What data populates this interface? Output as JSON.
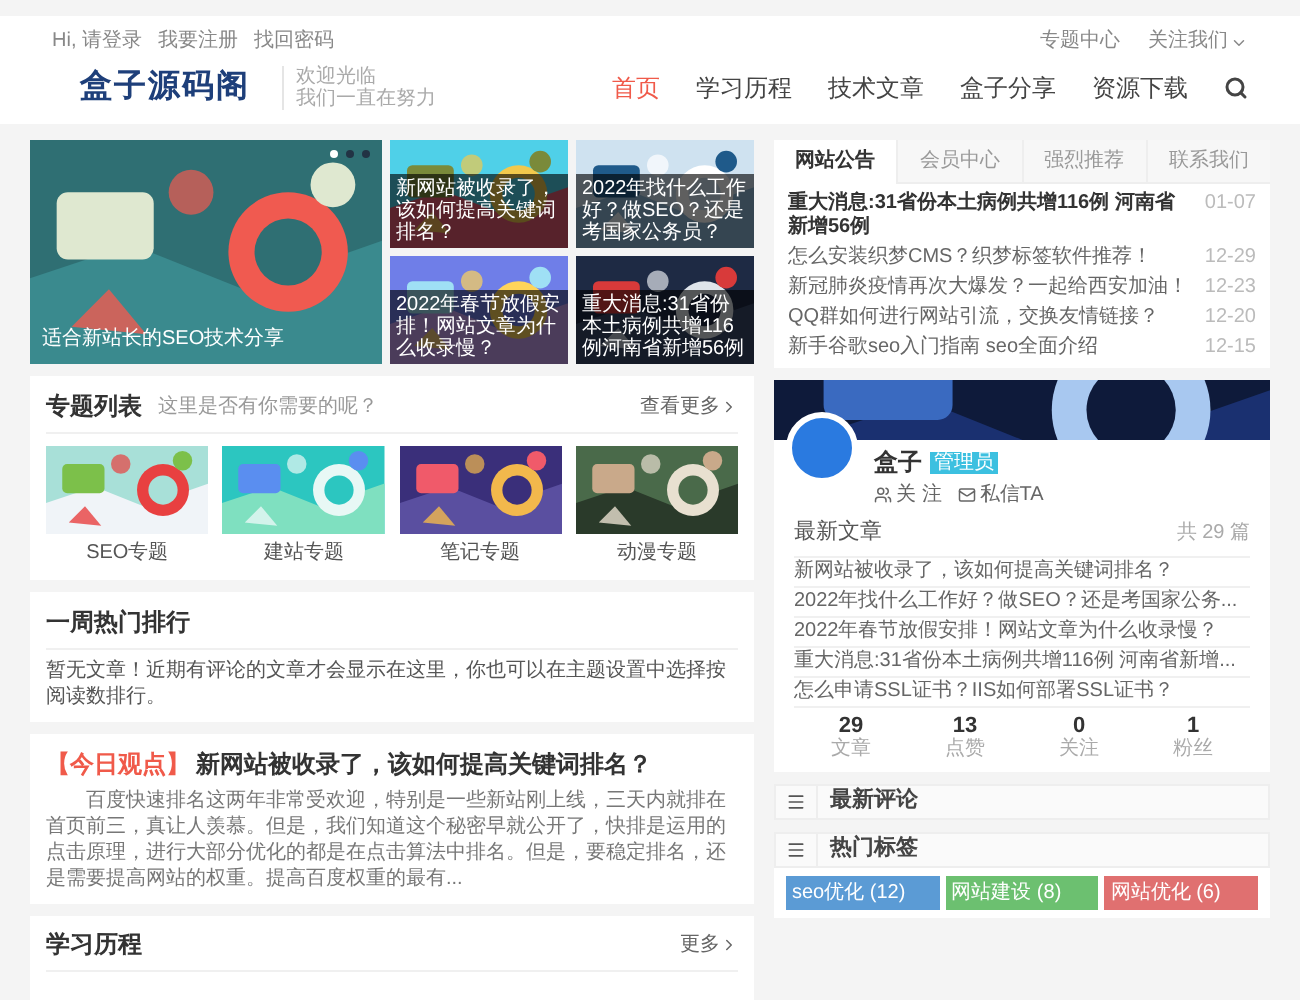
{
  "top_bar": {
    "left_links": [
      "Hi, 请登录",
      "我要注册",
      "找回密码"
    ],
    "right_links": [
      {
        "label": "专题中心",
        "dropdown": false
      },
      {
        "label": "关注我们",
        "dropdown": true
      }
    ]
  },
  "header": {
    "logo": "盒子源码阁",
    "tagline": [
      "欢迎光临",
      "我们一直在努力"
    ],
    "nav": [
      {
        "label": "首页",
        "selected": true
      },
      {
        "label": "学习历程",
        "selected": false
      },
      {
        "label": "技术文章",
        "selected": false
      },
      {
        "label": "盒子分享",
        "selected": false
      },
      {
        "label": "资源下载",
        "selected": false
      }
    ]
  },
  "slider": {
    "caption": "适合新站长的SEO技术分享",
    "dots": [
      {
        "selected": true
      },
      {
        "selected": false
      },
      {
        "selected": false
      }
    ],
    "cards": [
      {
        "caption": "新网站被收录了，该如何提高关键词排名？"
      },
      {
        "caption": "2022年找什么工作好？做SEO？还是考国家公务员？"
      },
      {
        "caption": "2022年春节放假安排！网站文章为什么收录慢？"
      },
      {
        "caption": "重大消息:31省份本土病例共增116例河南省新增56例"
      }
    ]
  },
  "topics": {
    "title": "专题列表",
    "subtitle": "这里是否有你需要的呢？",
    "more": "查看更多",
    "items": [
      "SEO专题",
      "建站专题",
      "笔记专题",
      "动漫专题"
    ]
  },
  "weekly": {
    "title": "一周热门排行",
    "text": "暂无文章！近期有评论的文章才会显示在这里，你也可以在主题设置中选择按阅读数排行。"
  },
  "today": {
    "tag": "【今日观点】",
    "title": "新网站被收录了，该如何提高关键词排名？",
    "excerpt": "百度快速排名这两年非常受欢迎，特别是一些新站刚上线，三天内就排在首页前三，真让人羡慕。但是，我们知道这个秘密早就公开了，快排是运用的点击原理，进行大部分优化的都是在点击算法中排名。但是，要稳定排名，还是需要提高网站的权重。提高百度权重的最有..."
  },
  "learning": {
    "title": "学习历程",
    "more": "更多"
  },
  "notice_tabs": [
    {
      "label": "网站公告",
      "selected": true
    },
    {
      "label": "会员中心",
      "selected": false
    },
    {
      "label": "强烈推荐",
      "selected": false
    },
    {
      "label": "联系我们",
      "selected": false
    }
  ],
  "notices": [
    {
      "title": "重大消息:31省份本土病例共增116例 河南省新增56例",
      "date": "01-07",
      "bold": true
    },
    {
      "title": "怎么安装织梦CMS？织梦标签软件推荐！",
      "date": "12-29",
      "bold": false
    },
    {
      "title": "新冠肺炎疫情再次大爆发？一起给西安加油！",
      "date": "12-23",
      "bold": false
    },
    {
      "title": "QQ群如何进行网站引流，交换友情链接？",
      "date": "12-20",
      "bold": false
    },
    {
      "title": "新手谷歌seo入门指南 seo全面介绍",
      "date": "12-15",
      "bold": false
    }
  ],
  "profile": {
    "name": "盒子",
    "badge": "管理员",
    "actions": [
      {
        "kind": "follow",
        "label": "关 注"
      },
      {
        "kind": "message",
        "label": "私信TA"
      }
    ],
    "latest_title": "最新文章",
    "latest_count": "共 29 篇",
    "articles": [
      "新网站被收录了，该如何提高关键词排名？",
      "2022年找什么工作好？做SEO？还是考国家公务...",
      "2022年春节放假安排！网站文章为什么收录慢？",
      "重大消息:31省份本土病例共增116例 河南省新增...",
      "怎么申请SSL证书？IIS如何部署SSL证书？"
    ],
    "stats": [
      {
        "value": "29",
        "label": "文章"
      },
      {
        "value": "13",
        "label": "点赞"
      },
      {
        "value": "0",
        "label": "关注"
      },
      {
        "value": "1",
        "label": "粉丝"
      }
    ]
  },
  "widgets": [
    {
      "title": "最新评论"
    },
    {
      "title": "热门标签"
    }
  ],
  "tags": [
    {
      "label": "seo优化 (12)",
      "color": "#5b9bd5"
    },
    {
      "label": "网站建设 (8)",
      "color": "#6cc070"
    },
    {
      "label": "网站优化 (6)",
      "color": "#e07070"
    }
  ]
}
